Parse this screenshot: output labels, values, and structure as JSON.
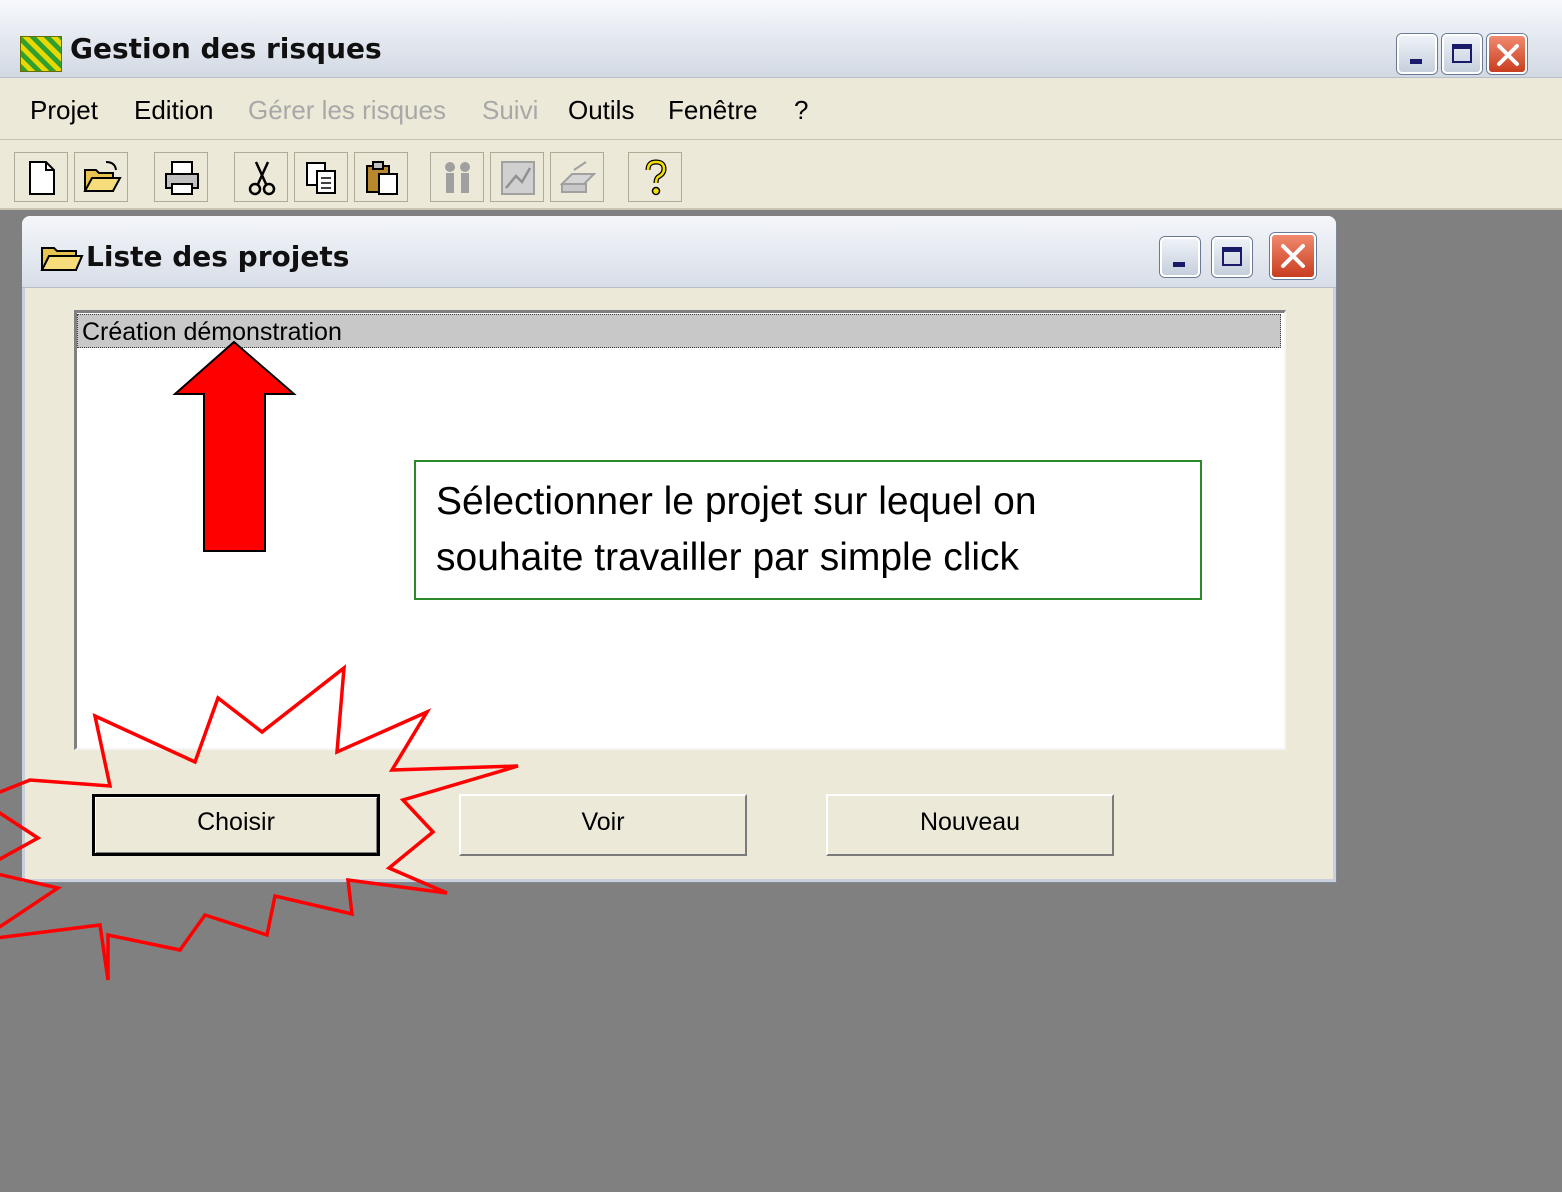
{
  "window": {
    "title": "Gestion des risques"
  },
  "menu": [
    {
      "label": "Projet",
      "disabled": false
    },
    {
      "label": "Edition",
      "disabled": false
    },
    {
      "label": "Gérer les risques",
      "disabled": true
    },
    {
      "label": "Suivi",
      "disabled": true
    },
    {
      "label": "Outils",
      "disabled": false
    },
    {
      "label": "Fenêtre",
      "disabled": false
    },
    {
      "label": "?",
      "disabled": false
    }
  ],
  "toolbar": [
    {
      "icon": "new-document-icon",
      "enabled": true
    },
    {
      "icon": "open-folder-icon",
      "enabled": true
    },
    {
      "icon": "printer-icon",
      "enabled": true
    },
    {
      "icon": "cut-icon",
      "enabled": true
    },
    {
      "icon": "copy-icon",
      "enabled": true
    },
    {
      "icon": "paste-icon",
      "enabled": true
    },
    {
      "icon": "people-icon",
      "enabled": false
    },
    {
      "icon": "chart-icon",
      "enabled": false
    },
    {
      "icon": "report-icon",
      "enabled": false
    },
    {
      "icon": "help-icon",
      "enabled": true
    }
  ],
  "child_window": {
    "title": "Liste des projets",
    "projects": [
      "Création démonstration"
    ],
    "selected_index": 0,
    "buttons": {
      "choose": "Choisir",
      "view": "Voir",
      "new": "Nouveau"
    }
  },
  "annotation": {
    "line1": "Sélectionner le projet sur lequel on",
    "line2": "souhaite travailler par simple click"
  },
  "colors": {
    "desktop": "#808080",
    "chrome": "#ece9d8",
    "arrow": "#ff0000",
    "callout_border": "#2a8a2a",
    "close_button": "#c93d1f"
  }
}
